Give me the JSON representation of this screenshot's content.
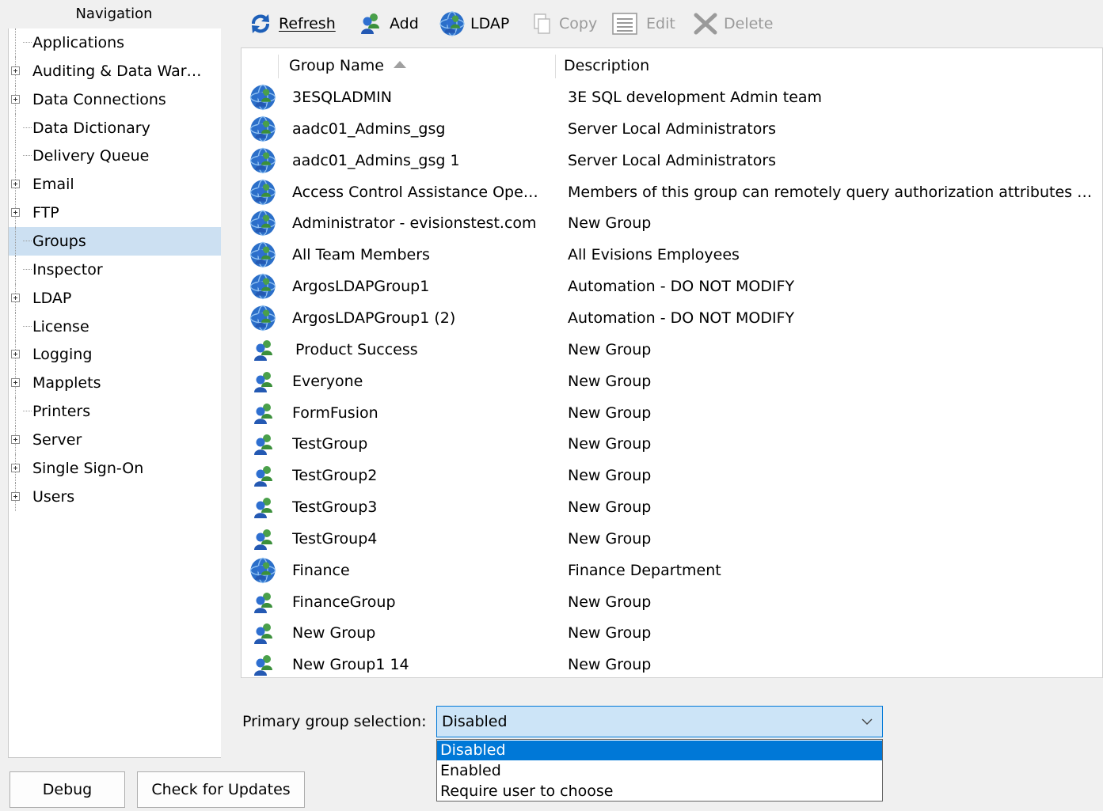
{
  "navigation": {
    "title": "Navigation",
    "items": [
      {
        "label": "Applications",
        "expandable": false
      },
      {
        "label": "Auditing & Data War…",
        "expandable": true
      },
      {
        "label": "Data Connections",
        "expandable": true
      },
      {
        "label": "Data Dictionary",
        "expandable": false
      },
      {
        "label": "Delivery Queue",
        "expandable": false
      },
      {
        "label": "Email",
        "expandable": true
      },
      {
        "label": "FTP",
        "expandable": true
      },
      {
        "label": "Groups",
        "expandable": false,
        "selected": true
      },
      {
        "label": "Inspector",
        "expandable": false
      },
      {
        "label": "LDAP",
        "expandable": true
      },
      {
        "label": "License",
        "expandable": false
      },
      {
        "label": "Logging",
        "expandable": true
      },
      {
        "label": "Mapplets",
        "expandable": true
      },
      {
        "label": "Printers",
        "expandable": false
      },
      {
        "label": "Server",
        "expandable": true
      },
      {
        "label": "Single Sign-On",
        "expandable": true
      },
      {
        "label": "Users",
        "expandable": true
      }
    ]
  },
  "toolbar": {
    "refresh_label": "Refresh",
    "add_label": "Add",
    "ldap_label": "LDAP",
    "copy_label": "Copy",
    "edit_label": "Edit",
    "delete_label": "Delete"
  },
  "grid": {
    "columns": {
      "name": "Group Name",
      "description": "Description"
    },
    "rows": [
      {
        "name": "3ESQLADMIN",
        "description": "3E SQL development Admin team",
        "icon": "ldap-group-icon"
      },
      {
        "name": "aadc01_Admins_gsg",
        "description": "Server Local Administrators",
        "icon": "ldap-group-icon"
      },
      {
        "name": "aadc01_Admins_gsg 1",
        "description": "Server Local Administrators",
        "icon": "ldap-group-icon"
      },
      {
        "name": "Access Control Assistance Ope…",
        "description": "Members of this group can remotely query authorization attributes …",
        "icon": "ldap-group-icon"
      },
      {
        "name": "Administrator - evisionstest.com",
        "description": "New Group",
        "icon": "ldap-group-icon"
      },
      {
        "name": "All Team Members",
        "description": "All Evisions Employees",
        "icon": "ldap-group-icon"
      },
      {
        "name": "ArgosLDAPGroup1",
        "description": "Automation - DO NOT MODIFY",
        "icon": "ldap-group-icon"
      },
      {
        "name": "ArgosLDAPGroup1 (2)",
        "description": "Automation - DO NOT MODIFY",
        "icon": "ldap-group-icon"
      },
      {
        "name": "Product Success",
        "description": "New Group",
        "icon": "group-icon"
      },
      {
        "name": "Everyone",
        "description": "New Group",
        "icon": "group-icon"
      },
      {
        "name": "FormFusion",
        "description": "New Group",
        "icon": "group-icon"
      },
      {
        "name": "TestGroup",
        "description": "New Group",
        "icon": "group-icon"
      },
      {
        "name": "TestGroup2",
        "description": "New Group",
        "icon": "group-icon"
      },
      {
        "name": "TestGroup3",
        "description": "New Group",
        "icon": "group-icon"
      },
      {
        "name": "TestGroup4",
        "description": "New Group",
        "icon": "group-icon"
      },
      {
        "name": "Finance",
        "description": "Finance Department",
        "icon": "ldap-group-icon"
      },
      {
        "name": "FinanceGroup",
        "description": "New Group",
        "icon": "group-icon"
      },
      {
        "name": "New Group",
        "description": "New Group",
        "icon": "group-icon"
      },
      {
        "name": "New Group1 14",
        "description": "New Group",
        "icon": "group-icon"
      }
    ]
  },
  "primary_group": {
    "label": "Primary group selection:",
    "value": "Disabled",
    "options": [
      "Disabled",
      "Enabled",
      "Require user to choose"
    ]
  },
  "bottom": {
    "debug_label": "Debug",
    "updates_label": "Check for Updates"
  },
  "colors": {
    "selection": "#cce0f2",
    "dropdown_highlight": "#0078d7",
    "group_icon": "#2b7fd4"
  }
}
